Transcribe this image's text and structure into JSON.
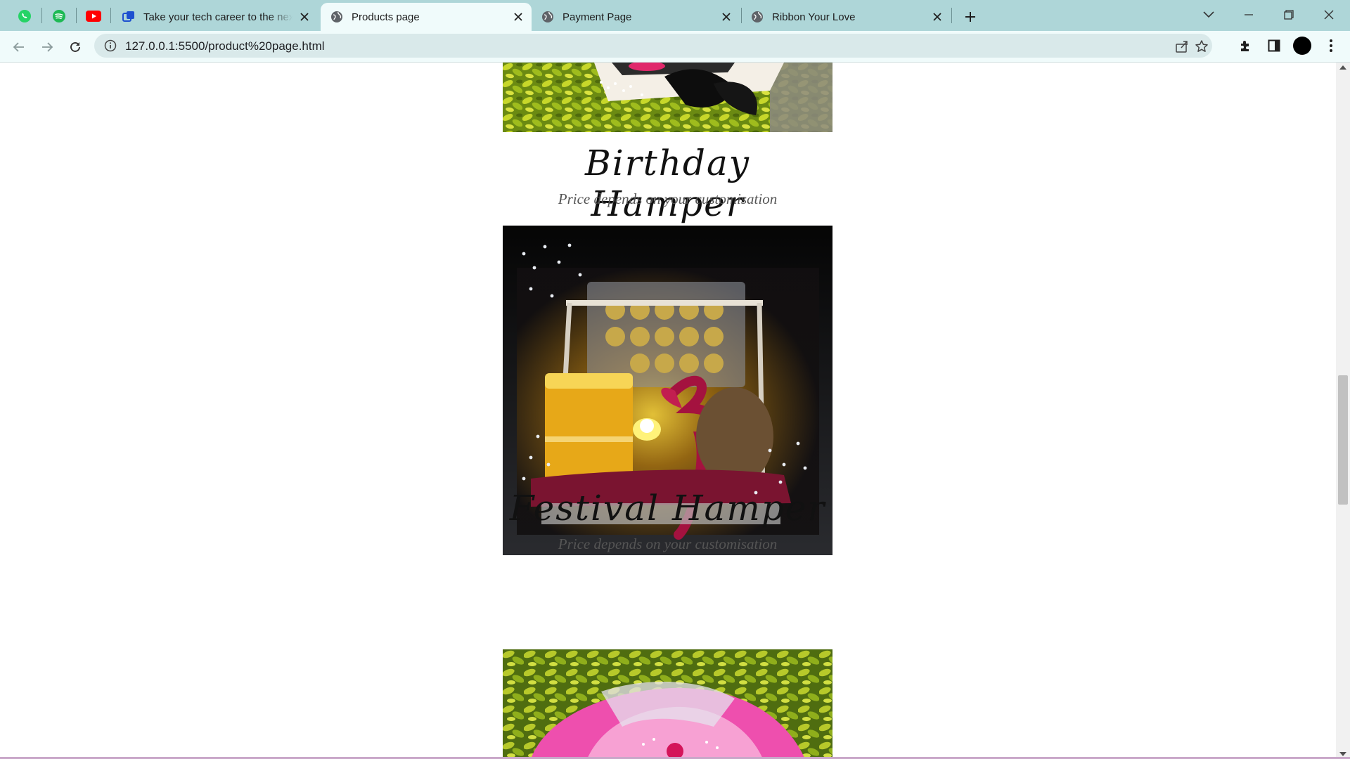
{
  "browser": {
    "pinned_tabs": [
      {
        "icon": "whatsapp-icon",
        "color": "#25d366"
      },
      {
        "icon": "spotify-icon",
        "color": "#1db954"
      },
      {
        "icon": "youtube-icon",
        "color": "#ff0000"
      }
    ],
    "tabs": [
      {
        "title": "Take your tech career to the next level",
        "active": false
      },
      {
        "title": "Products page",
        "active": true
      },
      {
        "title": "Payment Page",
        "active": false
      },
      {
        "title": "Ribbon Your Love",
        "active": false
      }
    ],
    "address": {
      "url": "127.0.0.1:5500/product%20page.html"
    },
    "colors": {
      "tabbar": "#aed6d8",
      "toolbar": "#f0fbfb",
      "omnibox": "#d9e9ea"
    }
  },
  "products": [
    {
      "title": "Birthday Hamper",
      "price_text": "Price depends on your customisation"
    },
    {
      "title": "Festival Hamper",
      "price_text": "Price depends on your customisation"
    }
  ]
}
